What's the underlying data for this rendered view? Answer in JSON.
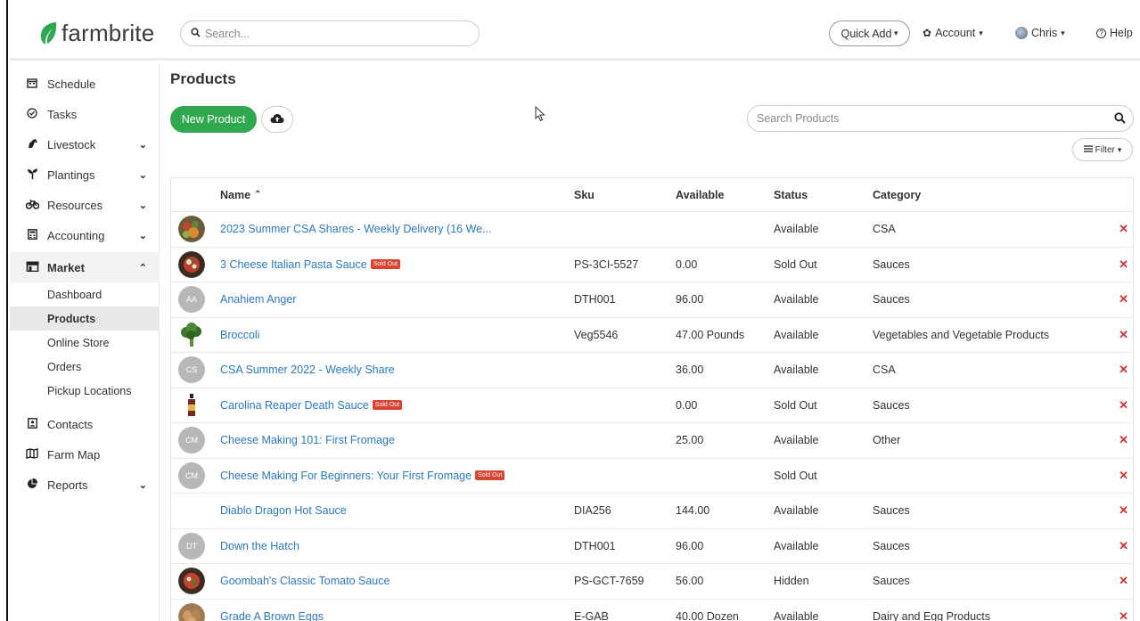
{
  "brand": {
    "name": "farmbrite",
    "color": "#2fa84f"
  },
  "header": {
    "search_placeholder": "Search...",
    "quick_add": "Quick Add",
    "account": "Account",
    "user": "Chris",
    "help": "Help"
  },
  "sidebar": {
    "items": [
      {
        "label": "Schedule",
        "icon": "calendar-icon"
      },
      {
        "label": "Tasks",
        "icon": "check-circle-icon"
      },
      {
        "label": "Livestock",
        "icon": "horse-icon"
      },
      {
        "label": "Plantings",
        "icon": "seedling-icon"
      },
      {
        "label": "Resources",
        "icon": "bicycle-icon"
      },
      {
        "label": "Accounting",
        "icon": "calculator-icon"
      },
      {
        "label": "Market",
        "icon": "store-icon"
      },
      {
        "label": "Contacts",
        "icon": "contact-card-icon"
      },
      {
        "label": "Farm Map",
        "icon": "map-icon"
      },
      {
        "label": "Reports",
        "icon": "pie-chart-icon"
      }
    ],
    "market_sub": [
      "Dashboard",
      "Products",
      "Online Store",
      "Orders",
      "Pickup Locations"
    ]
  },
  "main": {
    "title": "Products",
    "new_button": "New Product",
    "search_placeholder": "Search Products",
    "filter": "Filter"
  },
  "table": {
    "columns": {
      "name": "Name",
      "sku": "Sku",
      "available": "Available",
      "status": "Status",
      "category": "Category"
    },
    "sold_out_badge": "Sold Out",
    "rows": [
      {
        "thumb": "img",
        "name": "2023 Summer CSA Shares - Weekly Delivery (16 We...",
        "sku": "",
        "available": "",
        "status": "Available",
        "category": "CSA",
        "sold_out": false
      },
      {
        "thumb": "img",
        "name": "3 Cheese Italian Pasta Sauce",
        "sku": "PS-3CI-5527",
        "available": "0.00",
        "status": "Sold Out",
        "category": "Sauces",
        "sold_out": true
      },
      {
        "thumb": "AA",
        "name": "Anahiem Anger",
        "sku": "DTH001",
        "available": "96.00",
        "status": "Available",
        "category": "Sauces",
        "sold_out": false
      },
      {
        "thumb": "img",
        "name": "Broccoli",
        "sku": "Veg5546",
        "available": "47.00 Pounds",
        "status": "Available",
        "category": "Vegetables and Vegetable Products",
        "sold_out": false
      },
      {
        "thumb": "CS",
        "name": "CSA Summer 2022 - Weekly Share",
        "sku": "",
        "available": "36.00",
        "status": "Available",
        "category": "CSA",
        "sold_out": false
      },
      {
        "thumb": "img",
        "name": "Carolina Reaper Death Sauce",
        "sku": "",
        "available": "0.00",
        "status": "Sold Out",
        "category": "Sauces",
        "sold_out": true
      },
      {
        "thumb": "CM",
        "name": "Cheese Making 101: First Fromage",
        "sku": "",
        "available": "25.00",
        "status": "Available",
        "category": "Other",
        "sold_out": false
      },
      {
        "thumb": "CM",
        "name": "Cheese Making For Beginners: Your First Fromage",
        "sku": "",
        "available": "",
        "status": "Sold Out",
        "category": "",
        "sold_out": true
      },
      {
        "thumb": "",
        "name": "Diablo Dragon Hot Sauce",
        "sku": "DIA256",
        "available": "144.00",
        "status": "Available",
        "category": "Sauces",
        "sold_out": false
      },
      {
        "thumb": "DT",
        "name": "Down the Hatch",
        "sku": "DTH001",
        "available": "96.00",
        "status": "Available",
        "category": "Sauces",
        "sold_out": false
      },
      {
        "thumb": "img",
        "name": "Goombah's Classic Tomato Sauce",
        "sku": "PS-GCT-7659",
        "available": "56.00",
        "status": "Hidden",
        "category": "Sauces",
        "sold_out": false
      },
      {
        "thumb": "img",
        "name": "Grade A Brown Eggs",
        "sku": "E-GAB",
        "available": "40.00 Dozen",
        "status": "Available",
        "category": "Dairy and Egg Products",
        "sold_out": false
      }
    ]
  }
}
